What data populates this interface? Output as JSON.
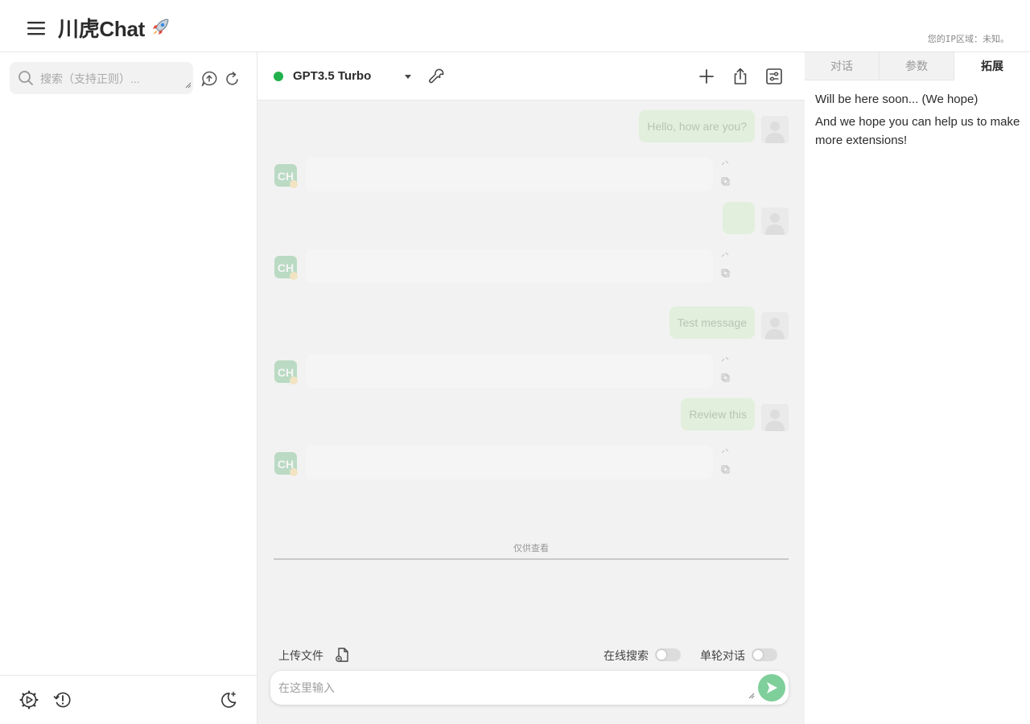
{
  "header": {
    "title": "川虎Chat",
    "ip_notice": "您的IP区域：未知。"
  },
  "sidebar": {
    "search_placeholder": "搜索（支持正则）...",
    "icons": [
      "upload-history-icon",
      "refresh-icon"
    ],
    "footer_icons": [
      "settings-icon",
      "history-icon",
      "dark-mode-icon"
    ]
  },
  "chat": {
    "model": "GPT3.5 Turbo",
    "status_color": "#22b14c",
    "messages": [
      {
        "role": "user",
        "text": "Hello, how are you?"
      },
      {
        "role": "assistant",
        "text": ""
      },
      {
        "role": "user",
        "text": ""
      },
      {
        "role": "assistant",
        "text": ""
      },
      {
        "role": "user",
        "text": "Test message"
      },
      {
        "role": "assistant",
        "text": ""
      },
      {
        "role": "user",
        "text": "Review this"
      },
      {
        "role": "assistant",
        "text": ""
      }
    ],
    "view_only_label": "仅供查看",
    "upload_label": "上传文件",
    "online_search_label": "在线搜索",
    "single_turn_label": "单轮对话",
    "input_placeholder": "在这里输入"
  },
  "panel": {
    "tabs": [
      {
        "label": "对话",
        "active": false
      },
      {
        "label": "参数",
        "active": false
      },
      {
        "label": "拓展",
        "active": true
      }
    ],
    "line1": "Will be here soon... (We hope)",
    "line2": "And we hope you can help us to make more extensions!"
  }
}
